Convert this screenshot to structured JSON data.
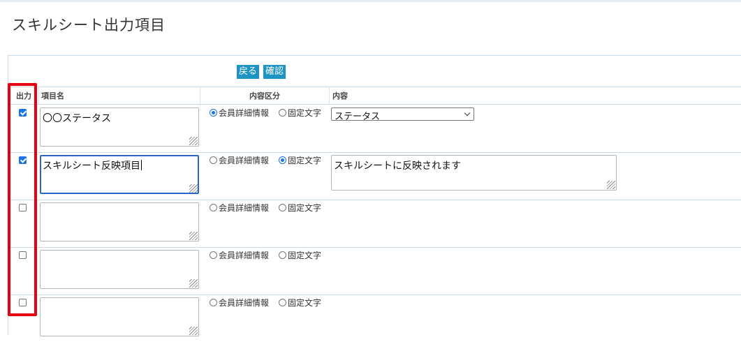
{
  "page": {
    "title": "スキルシート出力項目"
  },
  "toolbar": {
    "back_label": "戻る",
    "confirm_label": "確認"
  },
  "table": {
    "headers": {
      "output": "出力",
      "item_name": "項目名",
      "content_type": "内容区分",
      "content": "内容"
    },
    "radio_labels": {
      "member": "会員詳細情報",
      "fixed": "固定文字"
    },
    "rows": [
      {
        "checked": true,
        "name": "〇〇ステータス",
        "content_type": "member",
        "content": "ステータス"
      },
      {
        "checked": true,
        "name": "スキルシート反映項目",
        "content_type": "fixed",
        "content": "スキルシートに反映されます"
      },
      {
        "checked": false,
        "name": "",
        "content_type": "",
        "content": ""
      },
      {
        "checked": false,
        "name": "",
        "content_type": "",
        "content": ""
      },
      {
        "checked": false,
        "name": "",
        "content_type": "",
        "content": ""
      }
    ]
  },
  "colors": {
    "accent": "#1d94c4",
    "highlight": "#e8000f",
    "checkbox": "#1a73e8"
  }
}
